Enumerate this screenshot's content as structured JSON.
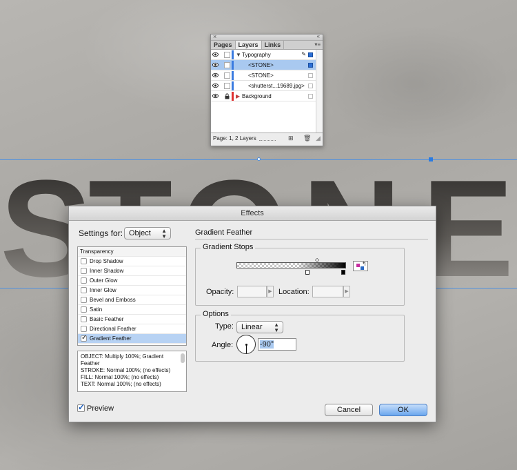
{
  "background": {
    "word": "STONE",
    "letters": [
      "S",
      "T",
      "O",
      "N",
      "E"
    ]
  },
  "layers_panel": {
    "tabs": [
      "Pages",
      "Layers",
      "Links"
    ],
    "active_tab": "Layers",
    "close_glyph": "×",
    "collapse_glyph": "«",
    "menu_glyph": "▾≡",
    "rows": [
      {
        "name": "Typography",
        "type": "layer",
        "color": "#3a7be0",
        "locked": false,
        "selected": false,
        "expanded": true
      },
      {
        "name": "<STONE>",
        "type": "object",
        "color": "#3a7be0",
        "locked": false,
        "selected": true
      },
      {
        "name": "<STONE>",
        "type": "object",
        "color": "#3a7be0",
        "locked": false,
        "selected": false
      },
      {
        "name": "<shutterst...19689.jpg>",
        "type": "object",
        "color": "#3a7be0",
        "locked": false,
        "selected": false
      },
      {
        "name": "Background",
        "type": "layer",
        "color": "#e03030",
        "locked": true,
        "selected": false,
        "expanded": false
      }
    ],
    "status": "Page: 1, 2 Layers"
  },
  "effects_dialog": {
    "title": "Effects",
    "settings_for_label": "Settings for:",
    "settings_for_value": "Object",
    "effects_list": {
      "header": "Transparency",
      "items": [
        {
          "label": "Drop Shadow",
          "checked": false,
          "selected": false
        },
        {
          "label": "Inner Shadow",
          "checked": false,
          "selected": false
        },
        {
          "label": "Outer Glow",
          "checked": false,
          "selected": false
        },
        {
          "label": "Inner Glow",
          "checked": false,
          "selected": false
        },
        {
          "label": "Bevel and Emboss",
          "checked": false,
          "selected": false
        },
        {
          "label": "Satin",
          "checked": false,
          "selected": false
        },
        {
          "label": "Basic Feather",
          "checked": false,
          "selected": false
        },
        {
          "label": "Directional Feather",
          "checked": false,
          "selected": false
        },
        {
          "label": "Gradient Feather",
          "checked": true,
          "selected": true
        }
      ]
    },
    "summary": [
      "OBJECT: Multiply 100%; Gradient Feather",
      "STROKE: Normal 100%; (no effects)",
      "FILL: Normal 100%; (no effects)",
      "TEXT: Normal 100%; (no effects)"
    ],
    "preview_label": "Preview",
    "preview_checked": true,
    "section_title": "Gradient Feather",
    "gradient_stops_title": "Gradient Stops",
    "opacity_label": "Opacity:",
    "opacity_value": "",
    "location_label": "Location:",
    "location_value": "",
    "options_title": "Options",
    "type_label": "Type:",
    "type_value": "Linear",
    "angle_label": "Angle:",
    "angle_value": "-90°",
    "cancel_label": "Cancel",
    "ok_label": "OK"
  }
}
